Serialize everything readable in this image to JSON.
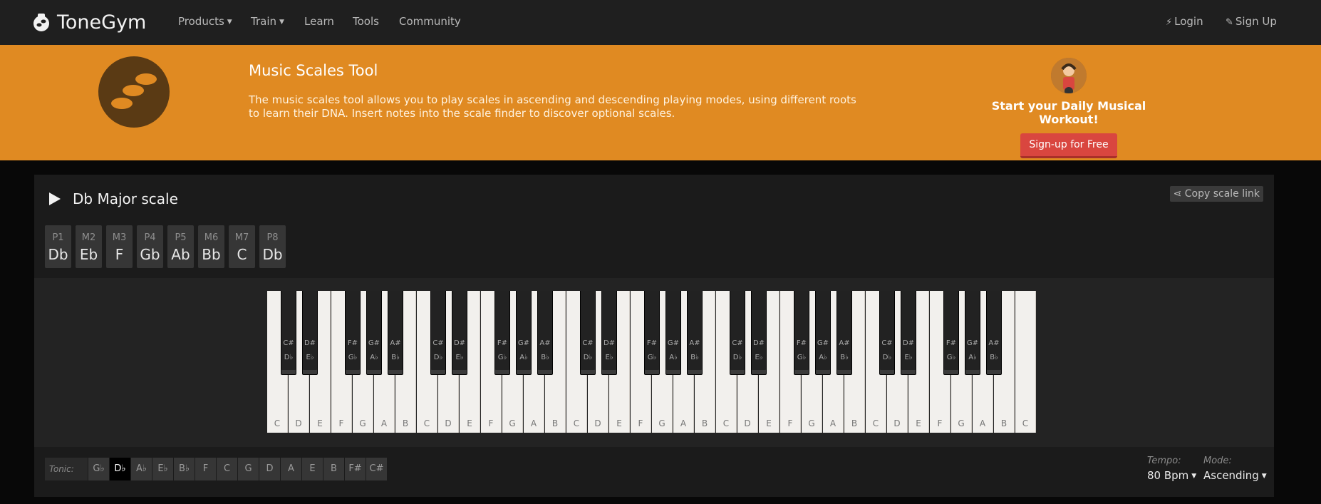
{
  "nav": {
    "brand": "ToneGym",
    "items": [
      {
        "label": "Products",
        "dropdown": true
      },
      {
        "label": "Train",
        "dropdown": true
      },
      {
        "label": "Learn",
        "dropdown": false
      },
      {
        "label": "Tools",
        "dropdown": false
      },
      {
        "label": "Community",
        "dropdown": false
      }
    ],
    "login": "Login",
    "signup": "Sign Up"
  },
  "banner": {
    "title": "Music Scales Tool",
    "description": "The music scales tool allows you to play scales in ascending and descending playing modes, using different roots to learn their DNA. Insert notes into the scale finder to discover optional scales.",
    "workout_text": "Start your Daily Musical Workout!",
    "signup_button": "Sign-up for Free",
    "background_color": "#e08a22"
  },
  "scale": {
    "title": "Db Major scale",
    "copy_link": "Copy scale link",
    "intervals": [
      {
        "degree": "P1",
        "note": "Db"
      },
      {
        "degree": "M2",
        "note": "Eb"
      },
      {
        "degree": "M3",
        "note": "F"
      },
      {
        "degree": "P4",
        "note": "Gb"
      },
      {
        "degree": "P5",
        "note": "Ab"
      },
      {
        "degree": "M6",
        "note": "Bb"
      },
      {
        "degree": "M7",
        "note": "C"
      },
      {
        "degree": "P8",
        "note": "Db"
      }
    ]
  },
  "keyboard": {
    "white_keys": [
      "C",
      "D",
      "E",
      "F",
      "G",
      "A",
      "B",
      "C",
      "D",
      "E",
      "F",
      "G",
      "A",
      "B",
      "C",
      "D",
      "E",
      "F",
      "G",
      "A",
      "B",
      "C",
      "D",
      "E",
      "F",
      "G",
      "A",
      "B",
      "C",
      "D",
      "E",
      "F",
      "G",
      "A",
      "B",
      "C"
    ],
    "black_keys_per_octave": [
      {
        "sharp": "C#",
        "flat": "D♭"
      },
      {
        "sharp": "D#",
        "flat": "E♭"
      },
      {
        "sharp": "F#",
        "flat": "G♭"
      },
      {
        "sharp": "G#",
        "flat": "A♭"
      },
      {
        "sharp": "A#",
        "flat": "B♭"
      }
    ],
    "octaves": 5
  },
  "controls": {
    "tonic_label": "Tonic:",
    "tonics": [
      "G♭",
      "D♭",
      "A♭",
      "E♭",
      "B♭",
      "F",
      "C",
      "G",
      "D",
      "A",
      "E",
      "B",
      "F#",
      "C#"
    ],
    "selected_tonic": "D♭",
    "tempo_label": "Tempo:",
    "tempo_value": "80 Bpm",
    "mode_label": "Mode:",
    "mode_value": "Ascending"
  }
}
